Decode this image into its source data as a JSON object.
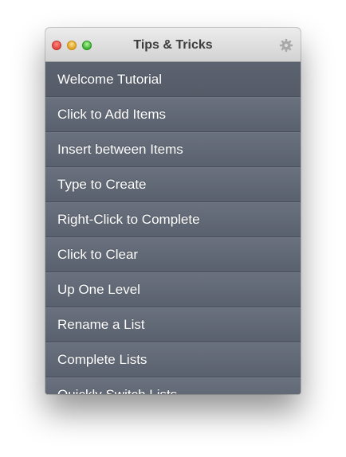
{
  "window": {
    "title": "Tips & Tricks"
  },
  "icons": {
    "close": "close-icon",
    "minimize": "minimize-icon",
    "zoom": "zoom-icon",
    "settings": "gear-icon"
  },
  "list": {
    "items": [
      {
        "label": "Welcome Tutorial"
      },
      {
        "label": "Click to Add Items"
      },
      {
        "label": "Insert between Items"
      },
      {
        "label": "Type to Create"
      },
      {
        "label": "Right-Click to Complete"
      },
      {
        "label": "Click to Clear"
      },
      {
        "label": "Up One Level"
      },
      {
        "label": "Rename a List"
      },
      {
        "label": "Complete Lists"
      },
      {
        "label": "Quickly Switch Lists"
      }
    ]
  }
}
